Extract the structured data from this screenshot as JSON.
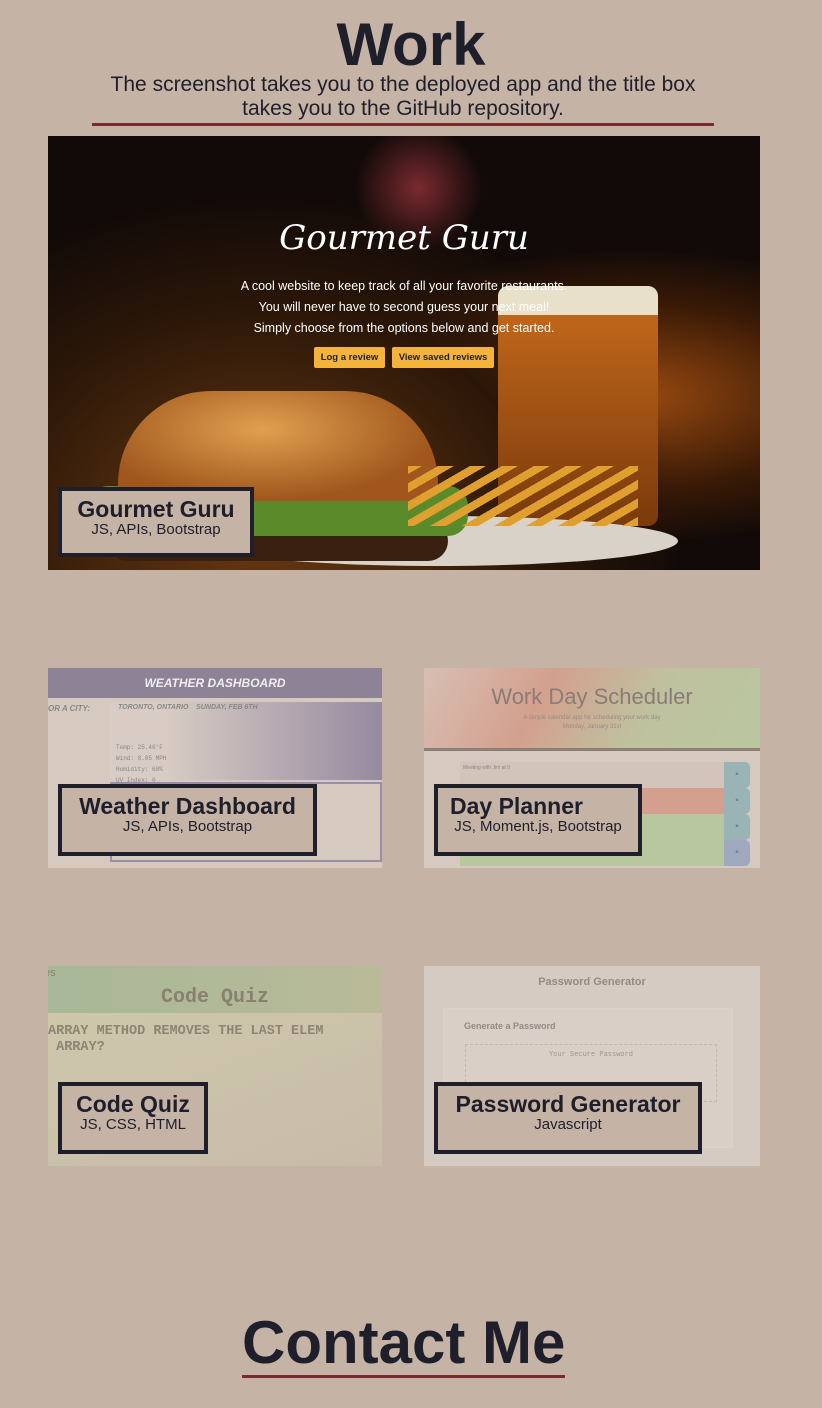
{
  "header": {
    "title": "Work",
    "subtitle": "The screenshot takes you to the deployed app and the title box takes you to the GitHub repository."
  },
  "projects": [
    {
      "title": "Gourmet Guru",
      "tech": "JS, APIs, Bootstrap",
      "preview": {
        "heading": "Gourmet Guru",
        "lines": [
          "A cool website to keep track of all your favorite restaurants.",
          "You will never have to second guess your next meal!",
          "Simply choose from the options below and get started."
        ],
        "buttons": [
          "Log a review",
          "View saved reviews"
        ]
      }
    },
    {
      "title": "Weather Dashboard",
      "tech": "JS, APIs, Bootstrap",
      "preview": {
        "heading": "WEATHER DASHBOARD",
        "search_label": "OR A CITY:",
        "city": "TORONTO, ONTARIO",
        "date": "SUNDAY, FEB 6TH",
        "stats": [
          "Temp: 25.46°F",
          "Wind: 8.05 MPH",
          "Humidity: 68%",
          "UV Index: 0"
        ]
      }
    },
    {
      "title": "Day Planner",
      "tech": "JS, Moment.js, Bootstrap",
      "preview": {
        "heading": "Work Day Scheduler",
        "subheading": "A simple calendar app for scheduling your work day",
        "date": "Monday, January 31st",
        "entry": "Meeting with Jim at 9"
      }
    },
    {
      "title": "Code Quiz",
      "tech": "JS, CSS, HTML",
      "preview": {
        "corner": "es",
        "heading": "Code Quiz",
        "question": "ARRAY METHOD REMOVES THE LAST ELEM\n ARRAY?"
      }
    },
    {
      "title": "Password Generator",
      "tech": "Javascript",
      "preview": {
        "heading": "Password Generator",
        "card_title": "Generate a Password",
        "placeholder": "Your Secure Password"
      }
    }
  ],
  "contact": {
    "title": "Contact Me"
  },
  "colors": {
    "background": "#c5b3a6",
    "text": "#1e1f2b",
    "accent": "#7a2a2a",
    "button": "#f3b33d"
  }
}
